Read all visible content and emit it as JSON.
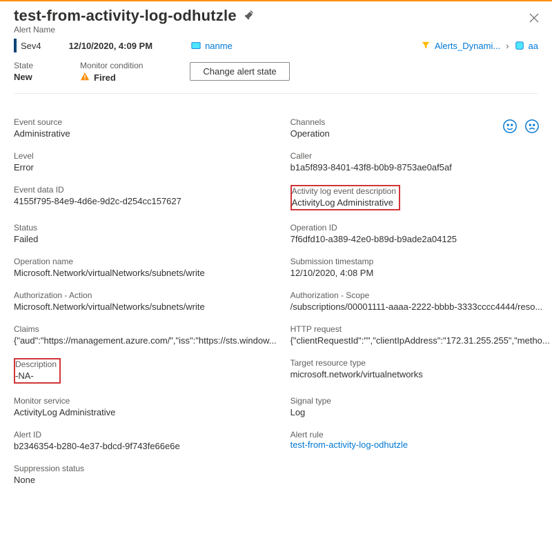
{
  "header": {
    "title": "test-from-activity-log-odhutzle",
    "subtitle": "Alert Name",
    "severity": "Sev4",
    "timestamp": "12/10/2020, 4:09 PM",
    "breadcrumb": {
      "scope": "nanme",
      "rule": "Alerts_Dynami...",
      "resource": "aa"
    }
  },
  "staterow": {
    "state_label": "State",
    "state_value": "New",
    "condition_label": "Monitor condition",
    "condition_value": "Fired",
    "change_button": "Change alert state"
  },
  "details": {
    "event_source": {
      "label": "Event source",
      "value": "Administrative"
    },
    "channels": {
      "label": "Channels",
      "value": "Operation"
    },
    "level": {
      "label": "Level",
      "value": "Error"
    },
    "caller": {
      "label": "Caller",
      "value": "b1a5f893-8401-43f8-b0b9-8753ae0af5af"
    },
    "event_data_id": {
      "label": "Event data ID",
      "value": "4155f795-84e9-4d6e-9d2c-d254cc157627"
    },
    "activity_log_desc": {
      "label": "Activity log event description",
      "value": "ActivityLog Administrative"
    },
    "status": {
      "label": "Status",
      "value": "Failed"
    },
    "operation_id": {
      "label": "Operation ID",
      "value": "7f6dfd10-a389-42e0-b89d-b9ade2a04125"
    },
    "operation_name": {
      "label": "Operation name",
      "value": "Microsoft.Network/virtualNetworks/subnets/write"
    },
    "submission_ts": {
      "label": "Submission timestamp",
      "value": "12/10/2020, 4:08 PM"
    },
    "auth_action": {
      "label": "Authorization - Action",
      "value": "Microsoft.Network/virtualNetworks/subnets/write"
    },
    "auth_scope": {
      "label": "Authorization - Scope",
      "value": "/subscriptions/00001111-aaaa-2222-bbbb-3333cccc4444/reso..."
    },
    "claims": {
      "label": "Claims",
      "value": "{\"aud\":\"https://management.azure.com/\",\"iss\":\"https://sts.window..."
    },
    "http_request": {
      "label": "HTTP request",
      "value": "{\"clientRequestId\":\"\",\"clientIpAddress\":\"172.31.255.255\",\"metho..."
    },
    "description": {
      "label": "Description",
      "value": "-NA-"
    },
    "target_res_type": {
      "label": "Target resource type",
      "value": "microsoft.network/virtualnetworks"
    },
    "monitor_service": {
      "label": "Monitor service",
      "value": "ActivityLog Administrative"
    },
    "signal_type": {
      "label": "Signal type",
      "value": "Log"
    },
    "alert_id": {
      "label": "Alert ID",
      "value": "b2346354-b280-4e37-bdcd-9f743fe66e6e"
    },
    "alert_rule": {
      "label": "Alert rule",
      "value": "test-from-activity-log-odhutzle"
    },
    "suppression": {
      "label": "Suppression status",
      "value": "None"
    }
  }
}
